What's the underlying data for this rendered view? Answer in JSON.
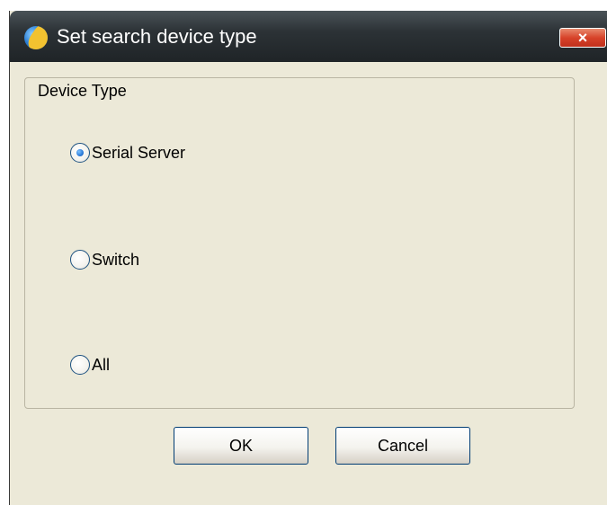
{
  "window": {
    "title": "Set search device type",
    "close_label": "×"
  },
  "group": {
    "legend": "Device Type"
  },
  "options": [
    {
      "label": "Serial Server",
      "checked": true
    },
    {
      "label": "Switch",
      "checked": false
    },
    {
      "label": "All",
      "checked": false
    }
  ],
  "buttons": {
    "ok_label": "OK",
    "cancel_label": "Cancel"
  },
  "colors": {
    "titlebar": "#2c3236",
    "dialog_bg": "#ece9d8",
    "close_button": "#d7432a",
    "radio_dot": "#2a7ad9"
  },
  "icons": {
    "app": "app-globe-icon",
    "close": "close-icon"
  }
}
